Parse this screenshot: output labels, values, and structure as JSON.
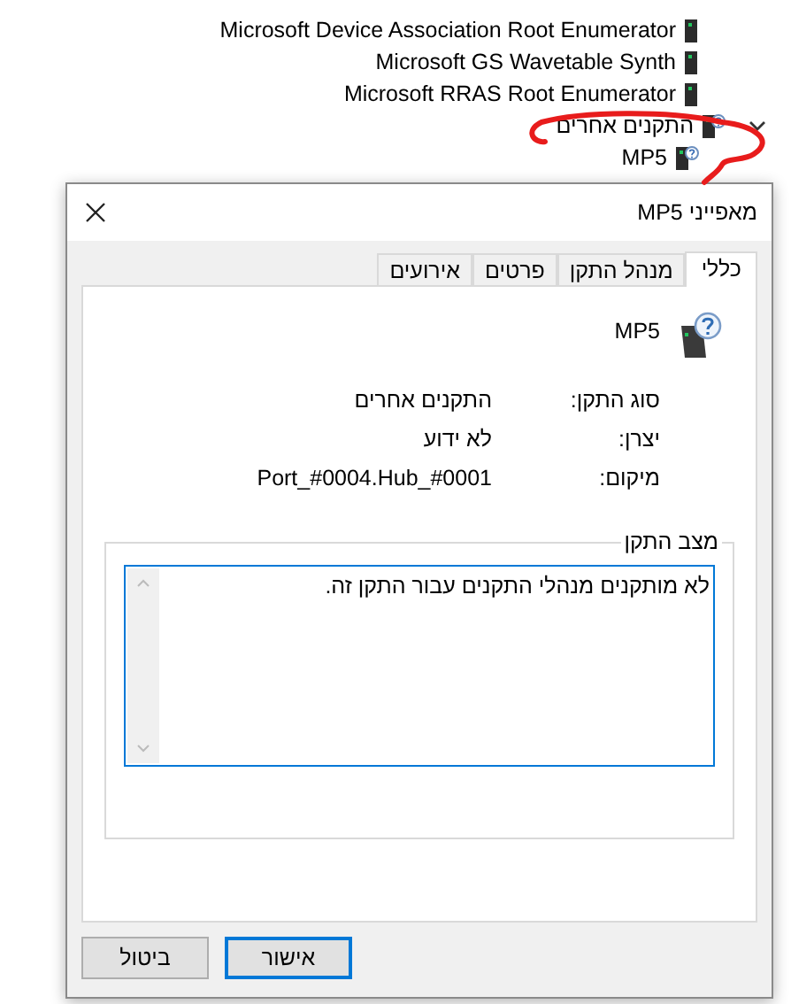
{
  "device_tree": {
    "items": [
      {
        "label": "Microsoft Device Association Root Enumerator",
        "kind": "device"
      },
      {
        "label": "Microsoft GS Wavetable Synth",
        "kind": "device"
      },
      {
        "label": "Microsoft RRAS Root Enumerator",
        "kind": "device"
      },
      {
        "label": "התקנים אחרים",
        "kind": "category",
        "expanded": true,
        "children": [
          {
            "label": "MP5",
            "kind": "unknown"
          }
        ]
      }
    ]
  },
  "dialog": {
    "title": "מאפייני MP5",
    "tabs": [
      {
        "label": "כללי",
        "selected": true
      },
      {
        "label": "מנהל התקן",
        "selected": false
      },
      {
        "label": "פרטים",
        "selected": false
      },
      {
        "label": "אירועים",
        "selected": false
      }
    ],
    "device_name": "MP5",
    "properties": [
      {
        "label": "סוג התקן:",
        "value": "התקנים אחרים"
      },
      {
        "label": "יצרן:",
        "value": "לא ידוע"
      },
      {
        "label": "מיקום:",
        "value": "Port_#0004.Hub_#0001"
      }
    ],
    "status_group": {
      "title": "מצב התקן",
      "text": "לא מותקנים מנהלי התקנים עבור התקן זה."
    },
    "buttons": [
      {
        "label": "אישור",
        "kind": "default"
      },
      {
        "label": "ביטול",
        "kind": "normal"
      }
    ]
  }
}
